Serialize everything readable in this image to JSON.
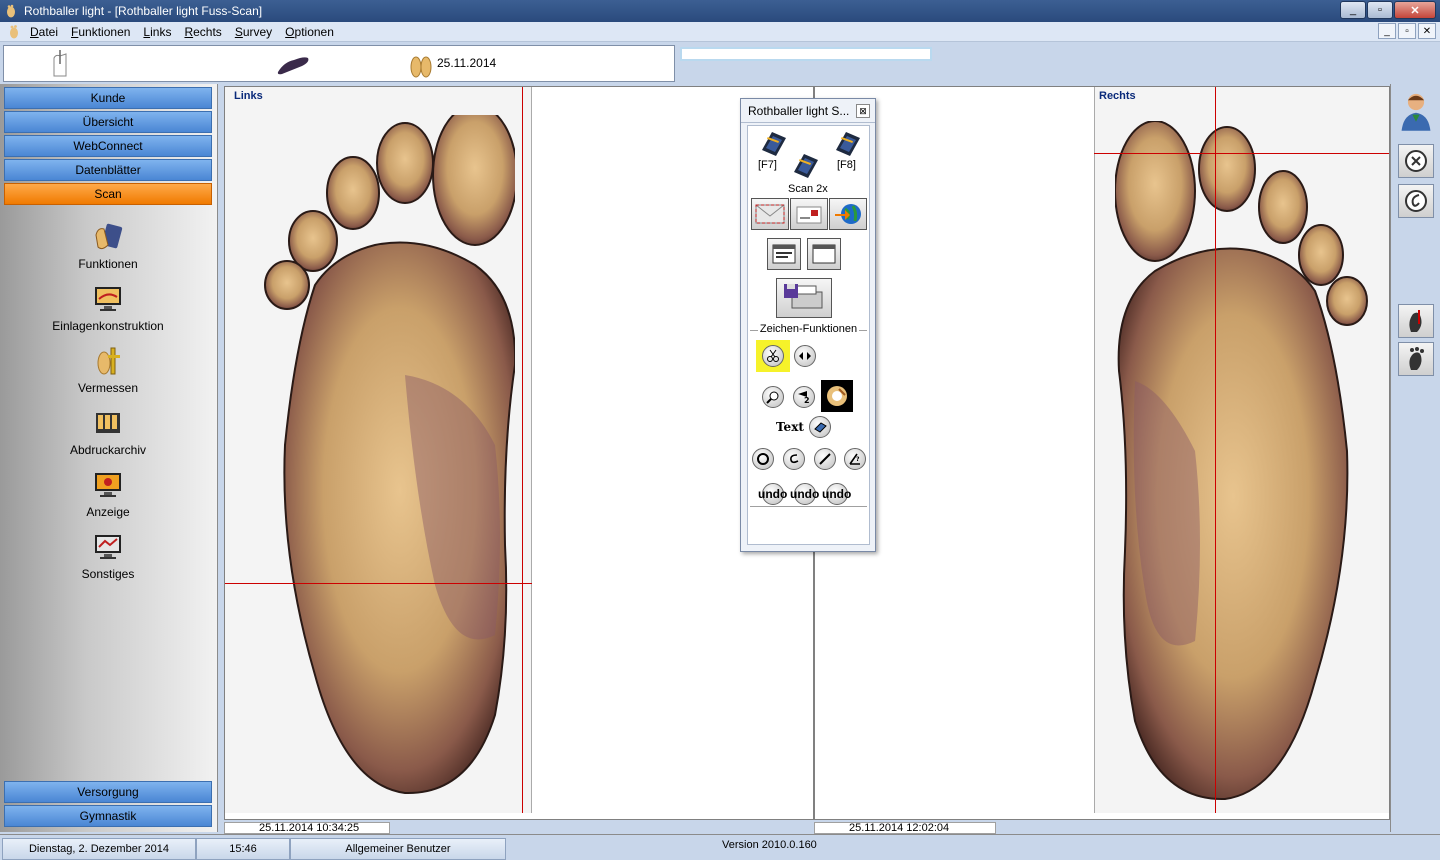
{
  "window": {
    "title": "Rothballer light - [Rothballer light Fuss-Scan]",
    "minimize": "_",
    "maximize": "▫",
    "close": "✕"
  },
  "menu": [
    "Datei",
    "Funktionen",
    "Links",
    "Rechts",
    "Survey",
    "Optionen"
  ],
  "mdi": {
    "minimize": "_",
    "restore": "▫",
    "close": "✕"
  },
  "toolbar": {
    "date": "25.11.2014"
  },
  "nav": {
    "top_buttons": [
      "Kunde",
      "Übersicht",
      "WebConnect",
      "Datenblätter",
      "Scan"
    ],
    "active": "Scan",
    "items": [
      {
        "label": "Funktionen",
        "icon": "hand-card-icon"
      },
      {
        "label": "Einlagenkonstruktion",
        "icon": "monitor-icon"
      },
      {
        "label": "Vermessen",
        "icon": "foot-measure-icon"
      },
      {
        "label": "Abdruckarchiv",
        "icon": "archive-icon"
      },
      {
        "label": "Anzeige",
        "icon": "monitor-display-icon"
      },
      {
        "label": "Sonstiges",
        "icon": "monitor-misc-icon"
      }
    ],
    "bottom_buttons": [
      "Versorgung",
      "Gymnastik"
    ]
  },
  "scans": {
    "left": {
      "label": "Links",
      "timestamp": "25.11.2014 10:34:25"
    },
    "right": {
      "label": "Rechts",
      "timestamp": "25.11.2014 12:02:04"
    }
  },
  "floatwin": {
    "title": "Rothballer light S...",
    "close": "⊠",
    "key_f7": "[F7]",
    "key_f8": "[F8]",
    "scan2x": "Scan 2x",
    "section": "Zeichen-Funktionen",
    "text_tool": "Text",
    "undo": [
      "undo",
      "undo",
      "undo"
    ]
  },
  "status": {
    "date": "Dienstag, 2. Dezember 2014",
    "time": "15:46",
    "user": "Allgemeiner Benutzer",
    "version": "Version 2010.0.160"
  },
  "colors": {
    "nav_blue": "#4a86d4",
    "nav_active": "#f07a00",
    "crosshair": "#cc0000"
  }
}
